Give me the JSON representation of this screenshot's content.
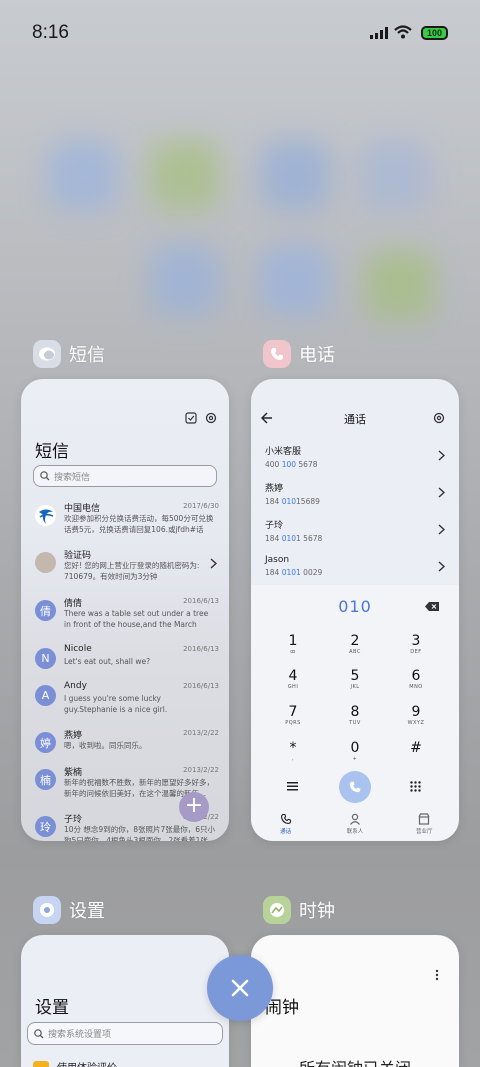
{
  "status_bar": {
    "time": "8:16",
    "battery": "100"
  },
  "apps": {
    "sms": {
      "label": "短信",
      "title": "短信",
      "search_placeholder": "搜索短信",
      "messages": [
        {
          "name": "中国电信",
          "date": "2017/6/30",
          "text": "欢迎参加积分兑换话费活动，每500分可兑换话费5元，兑换话费请回复106.或jfdh#话费...",
          "avatar": ""
        },
        {
          "name": "验证码",
          "date": "",
          "text": "您好! 您的网上营业厅登录的随机密码为: 710679。有效时间为3分钟",
          "avatar": ""
        },
        {
          "name": "倩倩",
          "date": "2016/6/13",
          "text": "There was a table set out under a tree in front of the house,and the March Hare and...",
          "avatar": "倩"
        },
        {
          "name": "Nicole",
          "date": "2016/6/13",
          "text": "Let's eat out, shall we?",
          "avatar": "N"
        },
        {
          "name": "Andy",
          "date": "2016/6/13",
          "text": "I guess you're some lucky guy.Stephanie is a nice girl.",
          "avatar": "A"
        },
        {
          "name": "燕婷",
          "date": "2013/2/22",
          "text": "嗯，收到啦。同乐同乐。",
          "avatar": "婷"
        },
        {
          "name": "紫楠",
          "date": "2013/2/22",
          "text": "新年的祝福数不胜数，新年的愿望好多好多，新年的问候依旧美好，在这个温馨的新年...",
          "avatar": "楠"
        },
        {
          "name": "子玲",
          "date": "2013/2/22",
          "text": "10分 想念9到的你，8张照片7张最你，6只小狗5只鹿你，4根鱼头3根面你，2张看着1张...",
          "avatar": "玲"
        }
      ],
      "fab": "+"
    },
    "phone": {
      "label": "电话",
      "title": "通话",
      "contacts": [
        {
          "name": "小米客服",
          "num_pre": "400 ",
          "num_hl": "100",
          "num_post": " 5678"
        },
        {
          "name": "燕婷",
          "num_pre": "184 ",
          "num_hl": "010",
          "num_post": "15689"
        },
        {
          "name": "子玲",
          "num_pre": "184 ",
          "num_hl": "010",
          "num_post": "1 5678"
        },
        {
          "name": "Jason",
          "num_pre": "184 ",
          "num_hl": "0101",
          "num_post": " 0029"
        }
      ],
      "dial_input": "010",
      "keys": [
        {
          "d": "1",
          "l": "ꝏ"
        },
        {
          "d": "2",
          "l": "ABC"
        },
        {
          "d": "3",
          "l": "DEF"
        },
        {
          "d": "4",
          "l": "GHI"
        },
        {
          "d": "5",
          "l": "JKL"
        },
        {
          "d": "6",
          "l": "MNO"
        },
        {
          "d": "7",
          "l": "PQRS"
        },
        {
          "d": "8",
          "l": "TUV"
        },
        {
          "d": "9",
          "l": "WXYZ"
        },
        {
          "d": "*",
          "l": ","
        },
        {
          "d": "0",
          "l": "+"
        },
        {
          "d": "#",
          "l": ""
        }
      ],
      "tabs": [
        "通话",
        "联系人",
        "营业厅"
      ]
    },
    "settings": {
      "label": "设置",
      "title": "设置",
      "search_placeholder": "搜索系统设置项",
      "first_item": "使用体验评价"
    },
    "clock": {
      "label": "时钟",
      "title": "闹钟",
      "status": "所有闹钟已关闭"
    }
  },
  "colors": {
    "accent": "#7b98d8",
    "sms_avatar": "#7a8fd6",
    "battery": "#3ec84a"
  }
}
